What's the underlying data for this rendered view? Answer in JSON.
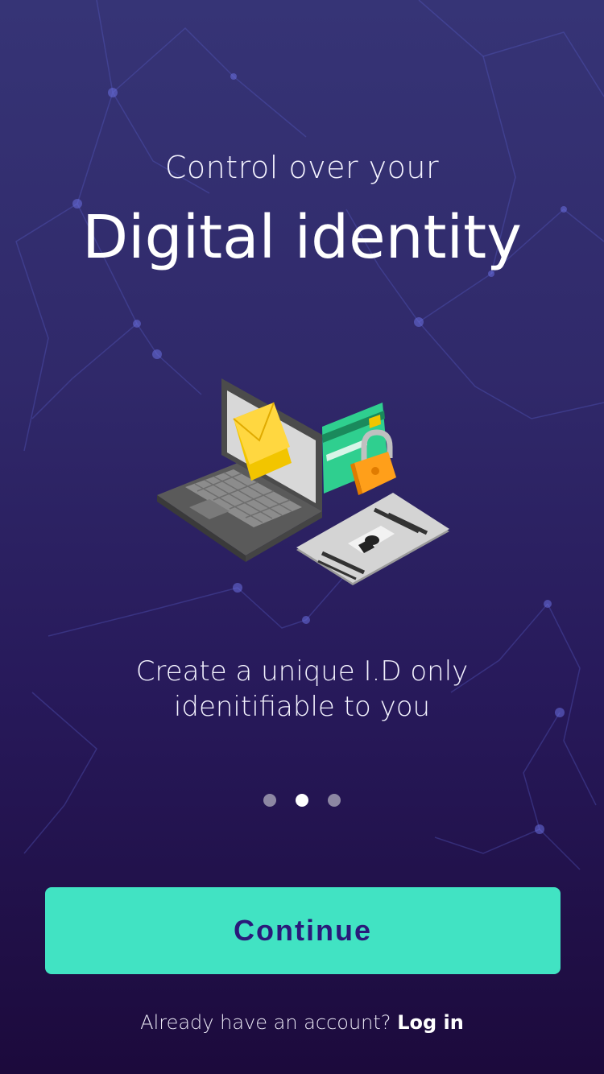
{
  "header": {
    "subtitle": "Control over your",
    "title": "Digital identity"
  },
  "illustration": {
    "icons": [
      "laptop-icon",
      "envelope-icon",
      "credit-card-icon",
      "padlock-icon",
      "id-card-icon"
    ]
  },
  "description": "Create a unique I.D only idenitifiable to you",
  "pagination": {
    "total_pages": 3,
    "active_page": 2
  },
  "continue_button": {
    "label": "Continue"
  },
  "login": {
    "prompt": "Already have an account?",
    "link": "Log in"
  },
  "colors": {
    "background_top": "#363476",
    "background_bottom": "#1c0a3c",
    "accent": "#41e3c3",
    "button_text": "#2a1a7a",
    "dot_inactive": "#8d87a3",
    "dot_active": "#ffffff"
  }
}
